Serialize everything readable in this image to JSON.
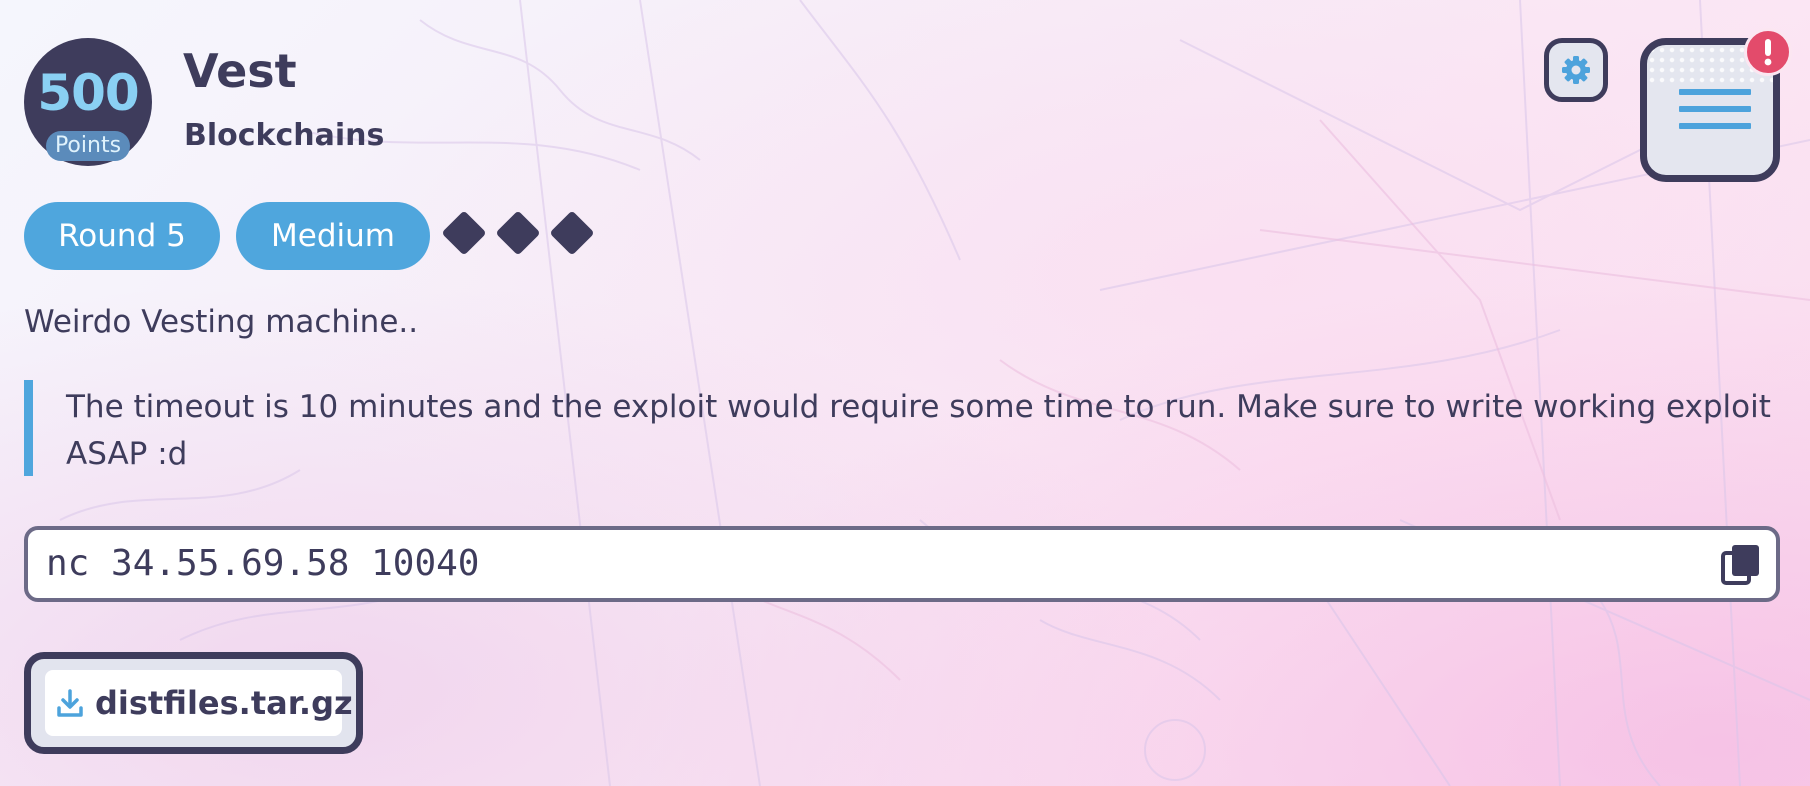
{
  "challenge": {
    "points_value": "500",
    "points_label": "Points",
    "title": "Vest",
    "category": "Blockchains",
    "tags": {
      "round": "Round 5",
      "difficulty": "Medium"
    },
    "difficulty_level": 3,
    "description": "Weirdo Vesting machine..",
    "note": "The timeout is 10 minutes and the exploit would require some time to run. Make sure to write working exploit ASAP :d",
    "connection_command": "nc 34.55.69.58 10040",
    "attachment": {
      "label": "distfiles.tar.gz",
      "icon": "download-icon"
    }
  },
  "controls": {
    "settings_icon": "gear-icon",
    "menu_icon": "hamburger-menu-icon",
    "alert_icon": "exclamation-icon",
    "copy_icon": "copy-icon"
  },
  "colors": {
    "navy": "#3e3c5c",
    "accent_blue": "#4fa6dd",
    "points_text": "#8ad0f3",
    "alert_red": "#e34b6b"
  }
}
